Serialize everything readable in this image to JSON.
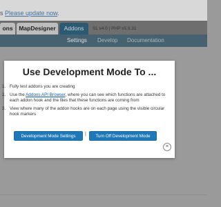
{
  "notice": {
    "prefix": "s ",
    "link_text": "Please update now",
    "suffix": "."
  },
  "app_tabs": [
    {
      "label": "ons"
    },
    {
      "label": "MapDesigner"
    },
    {
      "label": "Addons"
    }
  ],
  "version": "SL v4.0 | PHP v5.6.31",
  "subnav": {
    "items": [
      {
        "label": "Settings"
      },
      {
        "label": "Develop"
      },
      {
        "label": "Documentation"
      }
    ]
  },
  "modal": {
    "title": "Use Development Mode To ...",
    "items": [
      {
        "num": "1.",
        "text": "Fully test addons you are creating"
      },
      {
        "num": "2.",
        "text_before": "Use the ",
        "link": "Addons API Browser",
        "text_after": ", where you can see which functions are attached to each addon hook and the files that these functions are coming from"
      },
      {
        "num": "3.",
        "text": "View where many of the addon hooks are on each page using the visible circular hook markers"
      }
    ],
    "settings_button": "Development Mode Settings",
    "separator": "|",
    "off_button": "Turn Off Development Mode",
    "close": "×"
  },
  "colors": {
    "backdrop": "#9a9a9a",
    "accent_button": "#1f79b8",
    "active_tab": "#2d5a73",
    "subnav": "#3e5b6b"
  },
  "icons": {
    "close": "close-icon"
  }
}
